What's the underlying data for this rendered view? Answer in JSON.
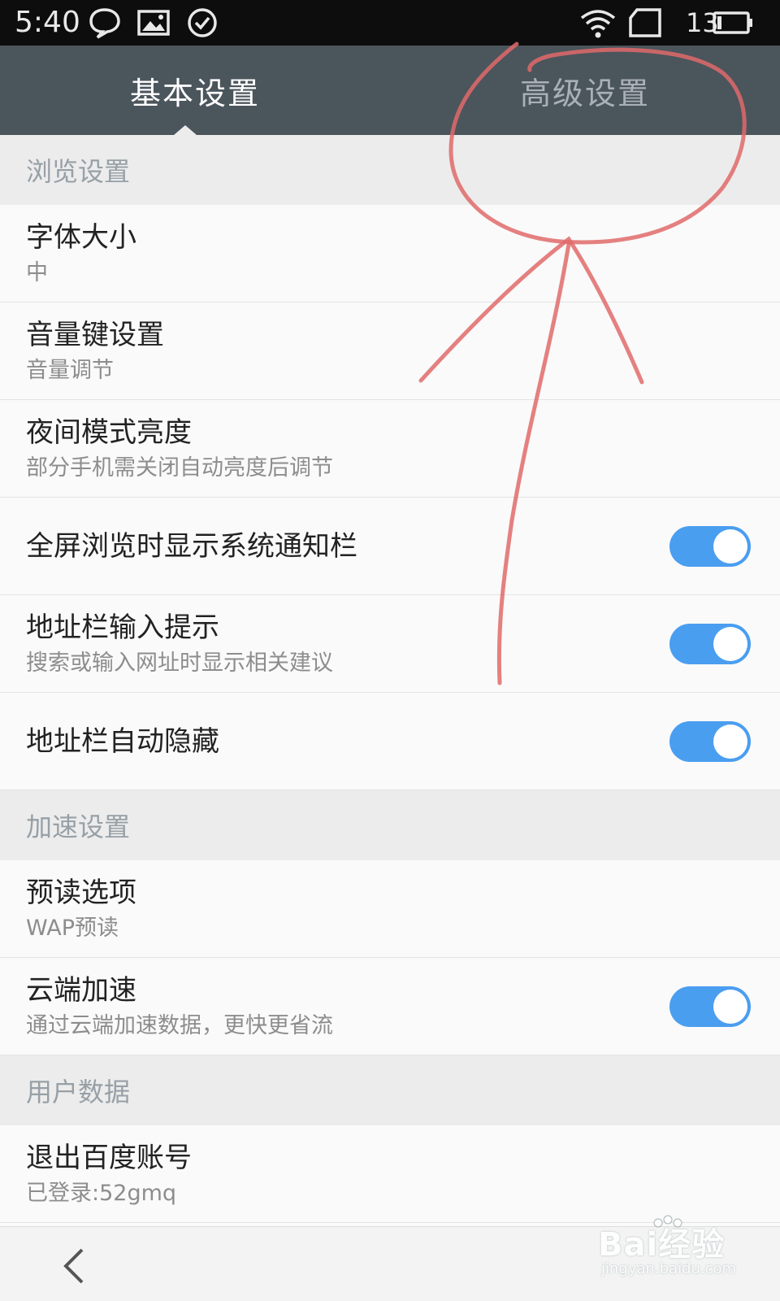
{
  "status_bar": {
    "time": "5:40",
    "battery_level": "13",
    "icons": [
      "chat-bubble-icon",
      "image-icon",
      "check-circle-icon",
      "wifi-icon",
      "sim-card-icon",
      "battery-icon"
    ]
  },
  "tabs": [
    {
      "label": "基本设置",
      "selected": true
    },
    {
      "label": "高级设置",
      "selected": false
    }
  ],
  "sections": {
    "browse": {
      "header": "浏览设置",
      "font_size": {
        "title": "字体大小",
        "subtitle": "中"
      },
      "volume_key": {
        "title": "音量键设置",
        "subtitle": "音量调节"
      },
      "night_brightness": {
        "title": "夜间模式亮度",
        "subtitle": "部分手机需关闭自动亮度后调节"
      },
      "fullscreen_notify": {
        "title": "全屏浏览时显示系统通知栏",
        "toggle_on": true
      },
      "address_hint": {
        "title": "地址栏输入提示",
        "subtitle": "搜索或输入网址时显示相关建议",
        "toggle_on": true
      },
      "address_autohide": {
        "title": "地址栏自动隐藏",
        "toggle_on": true
      }
    },
    "speed": {
      "header": "加速设置",
      "preread": {
        "title": "预读选项",
        "subtitle": "WAP预读"
      },
      "cloud": {
        "title": "云端加速",
        "subtitle": "通过云端加速数据，更快更省流",
        "toggle_on": true
      }
    },
    "user": {
      "header": "用户数据",
      "logout": {
        "title": "退出百度账号",
        "subtitle": "已登录:52gmq"
      }
    }
  },
  "watermark": {
    "brand": "Bai经验",
    "url": "jingyan.baidu.com"
  },
  "colors": {
    "tab_bar": "#4b555c",
    "toggle_on": "#4a9ef0",
    "annotation": "#e06a6a",
    "section_header_bg": "#ececec"
  }
}
